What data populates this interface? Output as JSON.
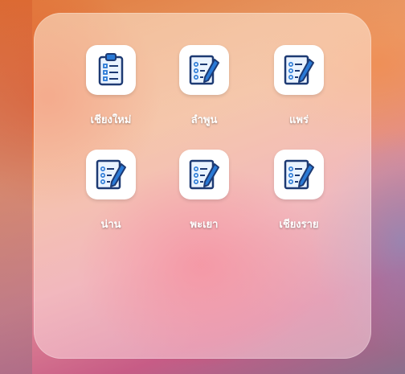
{
  "folder": {
    "apps": [
      {
        "label": "เชียงใหม่",
        "icon": "clipboard-checklist-icon"
      },
      {
        "label": "ลำพูน",
        "icon": "form-pencil-icon"
      },
      {
        "label": "แพร่",
        "icon": "form-pencil-icon"
      },
      {
        "label": "น่าน",
        "icon": "form-pencil-icon"
      },
      {
        "label": "พะเยา",
        "icon": "form-pencil-icon"
      },
      {
        "label": "เชียงราย",
        "icon": "form-pencil-icon"
      }
    ]
  },
  "colors": {
    "icon_blue": "#2a7ad6",
    "icon_navy": "#1d3a73",
    "tile_bg": "#ffffff"
  }
}
